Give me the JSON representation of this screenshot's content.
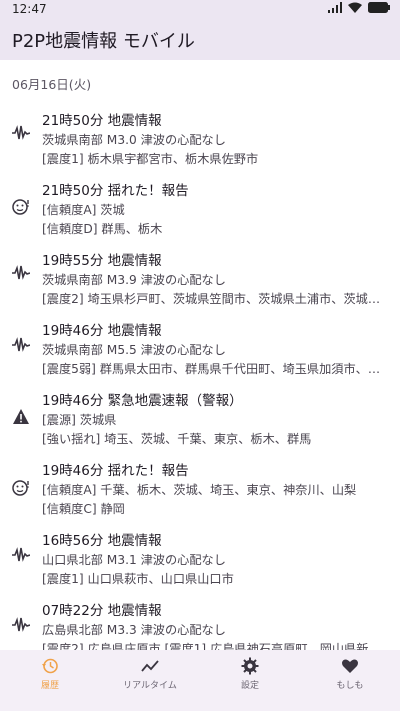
{
  "status_bar": {
    "time": "12:47"
  },
  "app_bar": {
    "title": "P2P地震情報 モバイル"
  },
  "date_header": "06月16日(火)",
  "items": [
    {
      "icon": "waveform-icon",
      "title": "21時50分 地震情報",
      "line2": "茨城県南部 M3.0 津波の心配なし",
      "line3": "[震度1] 栃木県宇都宮市、栃木県佐野市"
    },
    {
      "icon": "face-icon",
      "title": "21時50分 揺れた！報告",
      "line2": "[信頼度A] 茨城",
      "line3": "[信頼度D] 群馬、栃木"
    },
    {
      "icon": "waveform-icon",
      "title": "19時55分 地震情報",
      "line2": "茨城県南部 M3.9 津波の心配なし",
      "line3": "[震度2] 埼玉県杉戸町、茨城県笠間市、茨城県土浦市、茨城…"
    },
    {
      "icon": "waveform-icon",
      "title": "19時46分 地震情報",
      "line2": "茨城県南部 M5.5 津波の心配なし",
      "line3": "[震度5弱] 群馬県太田市、群馬県千代田町、埼玉県加須市、…"
    },
    {
      "icon": "warning-icon",
      "title": "19時46分 緊急地震速報（警報）",
      "line2": "[震源] 茨城県",
      "line3": "[強い揺れ] 埼玉、茨城、千葉、東京、栃木、群馬"
    },
    {
      "icon": "face-icon",
      "title": "19時46分 揺れた！報告",
      "line2": "[信頼度A] 千葉、栃木、茨城、埼玉、東京、神奈川、山梨",
      "line3": "[信頼度C] 静岡"
    },
    {
      "icon": "waveform-icon",
      "title": "16時56分 地震情報",
      "line2": "山口県北部 M3.1 津波の心配なし",
      "line3": "[震度1] 山口県萩市、山口県山口市"
    },
    {
      "icon": "waveform-icon",
      "title": "07時22分 地震情報",
      "line2": "広島県北部 M3.3 津波の心配なし",
      "line3": "[震度2] 広島県庄原市 [震度1] 広島県神石高原町、岡山県新…"
    }
  ],
  "nav": [
    {
      "icon": "history-icon",
      "label": "履歴",
      "active": true
    },
    {
      "icon": "timeline-icon",
      "label": "リアルタイム",
      "active": false
    },
    {
      "icon": "gear-icon",
      "label": "設定",
      "active": false
    },
    {
      "icon": "heart-icon",
      "label": "もしも",
      "active": false
    }
  ],
  "colors": {
    "app_bar_bg": "#ece6f2",
    "active_nav": "#f0a24a",
    "nav_bg": "#f4eff7"
  }
}
